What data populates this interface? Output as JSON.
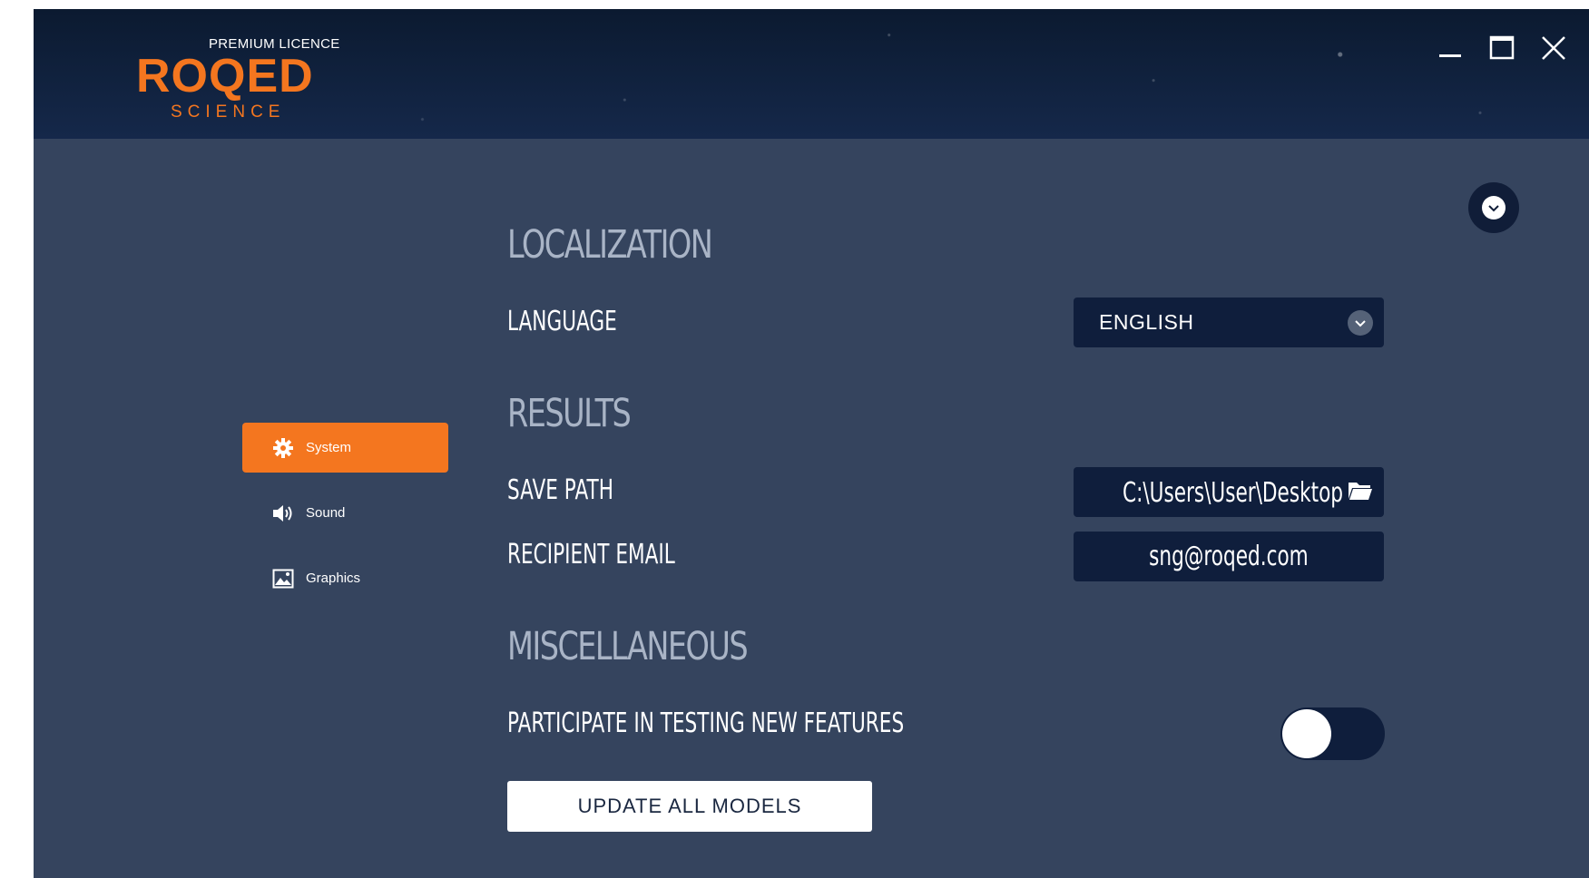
{
  "header": {
    "licence": "PREMIUM LICENCE",
    "logo_name": "ROQED",
    "logo_sub": "SCIENCE",
    "window_controls": [
      "minimize-icon",
      "maximize-icon",
      "close-icon"
    ]
  },
  "sidebar": {
    "items": [
      {
        "label": "System",
        "icon": "gear-icon",
        "active": true
      },
      {
        "label": "Sound",
        "icon": "speaker-icon",
        "active": false
      },
      {
        "label": "Graphics",
        "icon": "image-icon",
        "active": false
      }
    ]
  },
  "main": {
    "localization": {
      "title": "LOCALIZATION",
      "language_label": "LANGUAGE",
      "language_value": "ENGLISH"
    },
    "results": {
      "title": "RESULTS",
      "save_path_label": "SAVE PATH",
      "save_path_value": "C:\\Users\\User\\Desktop",
      "email_label": "RECIPIENT EMAIL",
      "email_value": "sng@roqed.com"
    },
    "misc": {
      "title": "MISCELLANEOUS",
      "testing_label": "PARTICIPATE IN TESTING NEW FEATURES",
      "testing_enabled": false,
      "update_button": "UPDATE ALL MODELS"
    }
  },
  "colors": {
    "accent": "#f4761f",
    "background": "#35445e",
    "field": "#0f1e3c",
    "header": "#0f1e36"
  }
}
